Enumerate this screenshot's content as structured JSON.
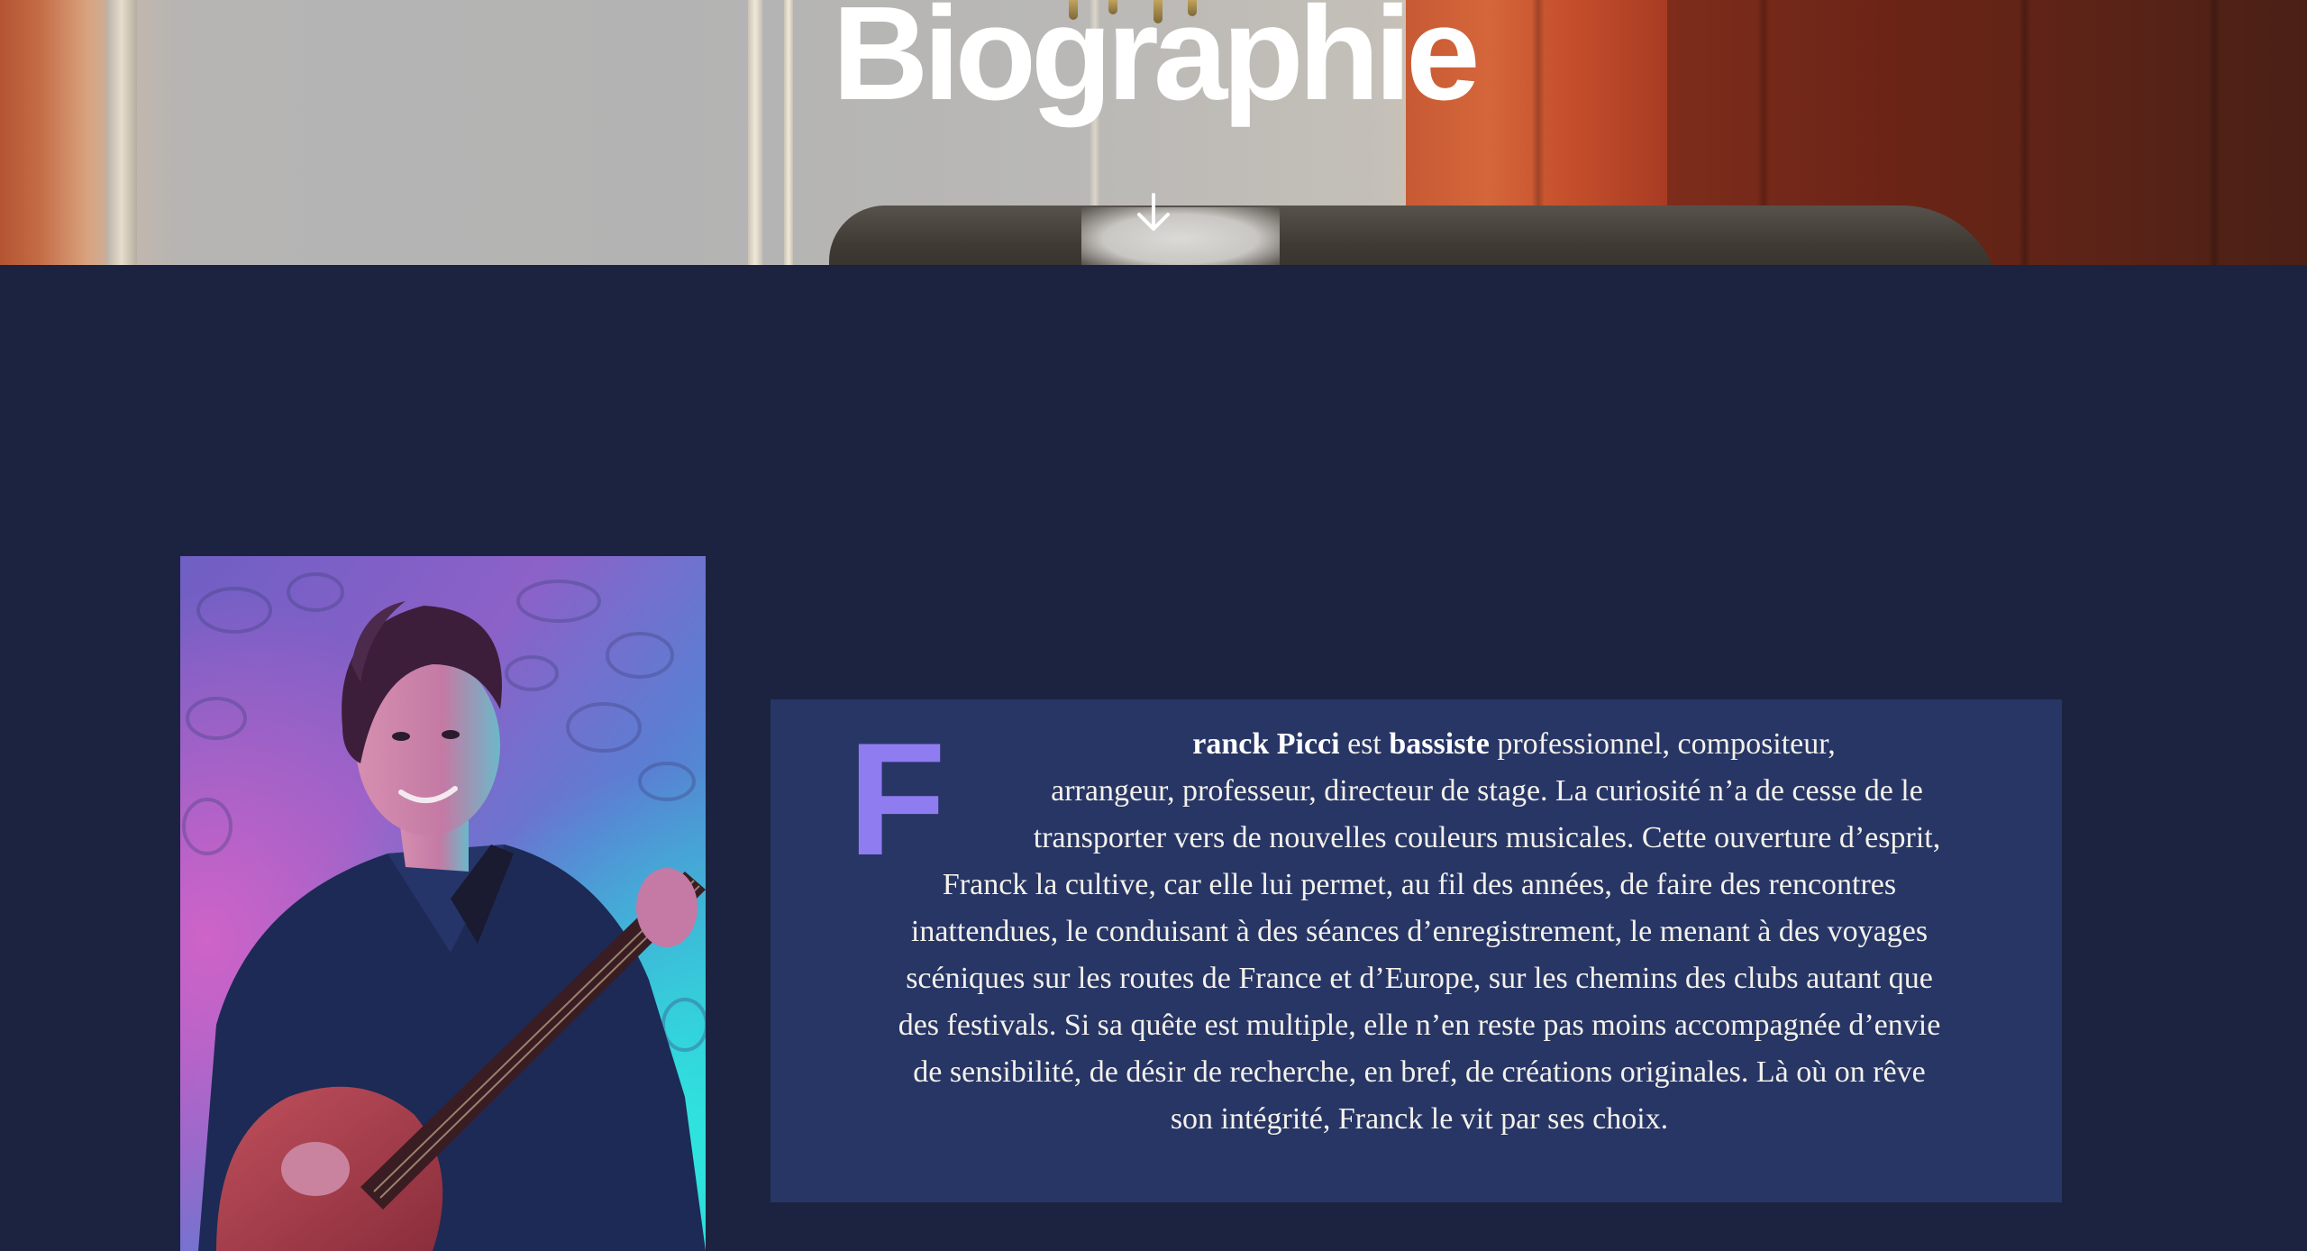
{
  "hero": {
    "title": "Biographie",
    "scroll_icon": "arrow-down-icon"
  },
  "portrait": {
    "alt": "Franck Picci"
  },
  "bio": {
    "drop_cap": "F",
    "line1": {
      "name": "ranck Picci",
      "mid": " est ",
      "role": "bassiste",
      "rest": " professionnel, compositeur,"
    },
    "lines": [
      "arrangeur, professeur, directeur de stage. La curiosité n’a de cesse de le",
      "transporter vers de nouvelles couleurs musicales. Cette ouverture d’esprit,",
      "Franck la cultive, car elle lui permet, au fil des années, de faire des rencontres",
      "inattendues, le conduisant à des séances d’enregistrement, le menant à des voyages",
      "scéniques sur les routes de France et d’Europe, sur les chemins des clubs autant que",
      "des festivals. Si sa quête est multiple, elle n’en reste pas moins accompagnée d’envie",
      "de sensibilité, de désir de recherche, en bref, de créations originales. Là où on rêve",
      "son intégrité, Franck le vit par ses choix."
    ]
  },
  "colors": {
    "page_background": "#1b2340",
    "card_background": "#283666",
    "drop_cap": "#8f7cf0",
    "text": "#f3f1ea"
  }
}
